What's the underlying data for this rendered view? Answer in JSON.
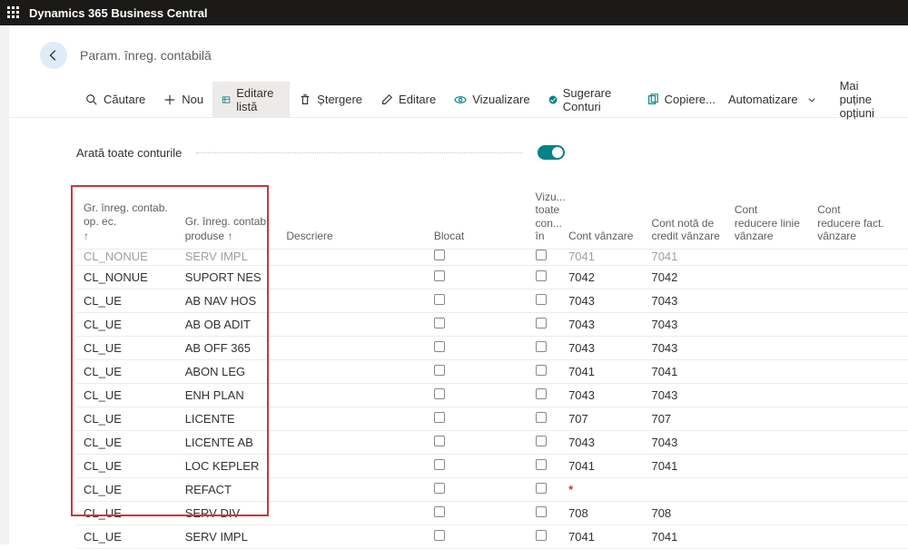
{
  "topbar": {
    "title": "Dynamics 365 Business Central"
  },
  "page": {
    "title": "Param. înreg. contabilă"
  },
  "toolbar": {
    "search": "Căutare",
    "new": "Nou",
    "editlist": "Editare listă",
    "delete": "Ștergere",
    "edit": "Editare",
    "view": "Vizualizare",
    "suggest": "Sugerare Conturi",
    "copy": "Copiere...",
    "automate": "Automatizare",
    "fewer": "Mai puține opțiuni"
  },
  "toggle": {
    "label": "Arată toate conturile"
  },
  "columns": {
    "ec": "Gr. înreg. contab. op. ec.",
    "prod": "Gr. înreg. contab. produse",
    "desc": "Descriere",
    "bloc": "Blocat",
    "vtc": "Vizu... toate con... în",
    "cv": "Cont vânzare",
    "cncv": "Cont notă de credit vânzare",
    "crlv": "Cont reducere linie vânzare",
    "crfv": "Cont reducere fact. vânzare"
  },
  "sort_indicator": "↑",
  "rows": [
    {
      "partial": true,
      "ec": "CL_NONUE",
      "prod": "SERV IMPL",
      "cv": "7041",
      "cncv": "7041"
    },
    {
      "ec": "CL_NONUE",
      "prod": "SUPORT NES",
      "cv": "7042",
      "cncv": "7042"
    },
    {
      "ec": "CL_UE",
      "prod": "AB NAV HOS",
      "cv": "7043",
      "cncv": "7043"
    },
    {
      "ec": "CL_UE",
      "prod": "AB OB ADIT",
      "cv": "7043",
      "cncv": "7043"
    },
    {
      "ec": "CL_UE",
      "prod": "AB OFF 365",
      "cv": "7043",
      "cncv": "7043"
    },
    {
      "ec": "CL_UE",
      "prod": "ABON LEG",
      "cv": "7041",
      "cncv": "7041"
    },
    {
      "ec": "CL_UE",
      "prod": "ENH PLAN",
      "cv": "7043",
      "cncv": "7043"
    },
    {
      "ec": "CL_UE",
      "prod": "LICENTE",
      "cv": "707",
      "cncv": "707"
    },
    {
      "ec": "CL_UE",
      "prod": "LICENTE AB",
      "cv": "7043",
      "cncv": "7043"
    },
    {
      "ec": "CL_UE",
      "prod": "LOC KEPLER",
      "cv": "7041",
      "cncv": "7041"
    },
    {
      "ec": "CL_UE",
      "prod": "REFACT",
      "cv": "*",
      "cncv": "",
      "ast": true
    },
    {
      "ec": "CL_UE",
      "prod": "SERV DIV",
      "cv": "708",
      "cncv": "708"
    },
    {
      "ec": "CL_UE",
      "prod": "SERV IMPL",
      "cv": "7041",
      "cncv": "7041"
    }
  ]
}
